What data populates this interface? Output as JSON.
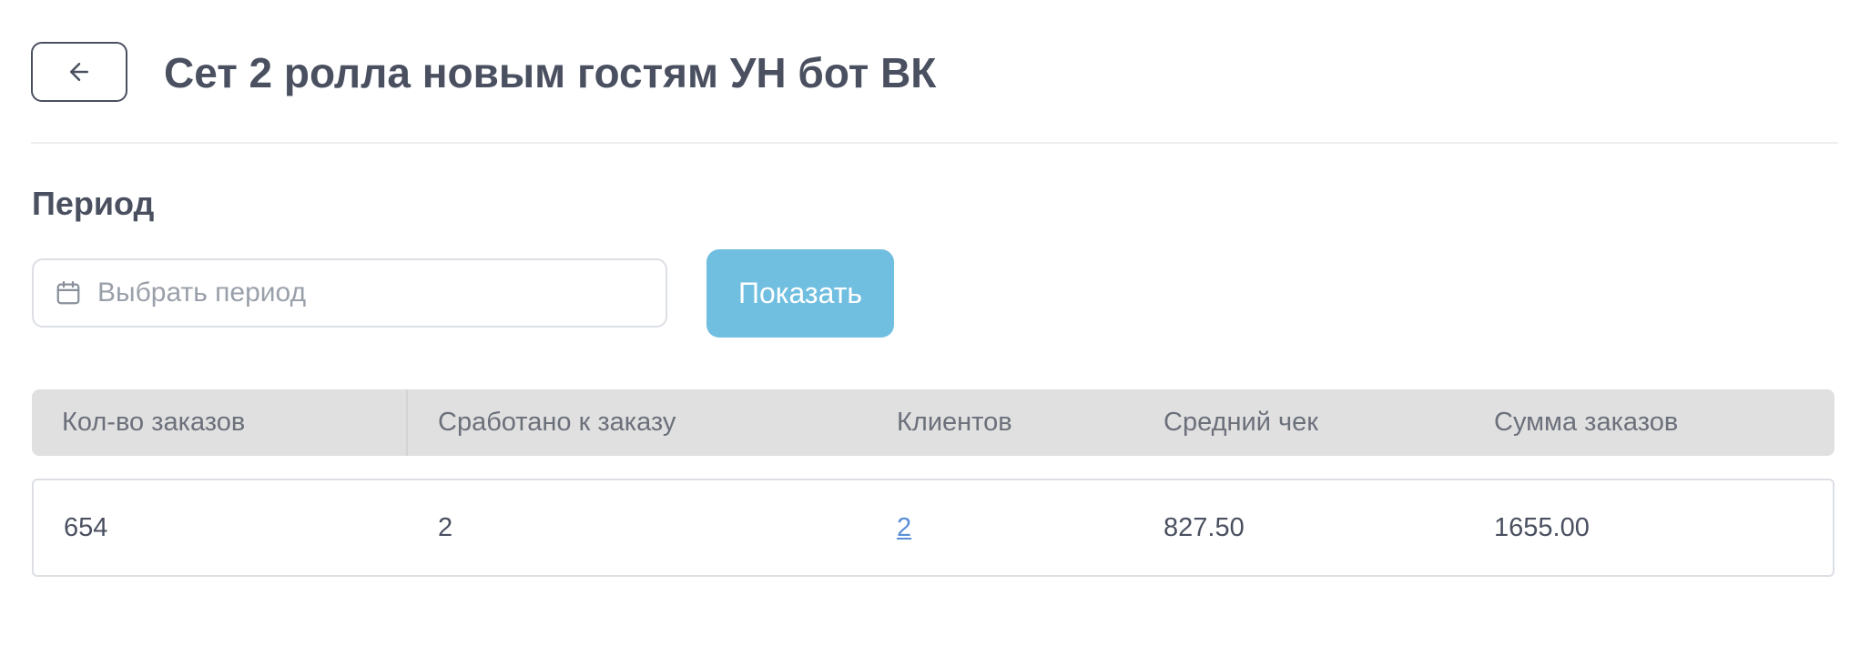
{
  "header": {
    "title": "Сет 2 ролла новым гостям УН бот ВК",
    "back_icon": "arrow-left-icon"
  },
  "period": {
    "title": "Период",
    "input_placeholder": "Выбрать период",
    "input_value": "",
    "calendar_icon": "calendar-icon",
    "show_button_label": "Показать",
    "accent_color": "#70bfe0"
  },
  "table": {
    "columns": [
      "Кол-во заказов",
      "Сработано к заказу",
      "Клиентов",
      "Средний чек",
      "Сумма заказов"
    ],
    "rows": [
      {
        "orders_count": "654",
        "triggered": "2",
        "clients": "2",
        "avg_check": "827.50",
        "total": "1655.00"
      }
    ]
  }
}
